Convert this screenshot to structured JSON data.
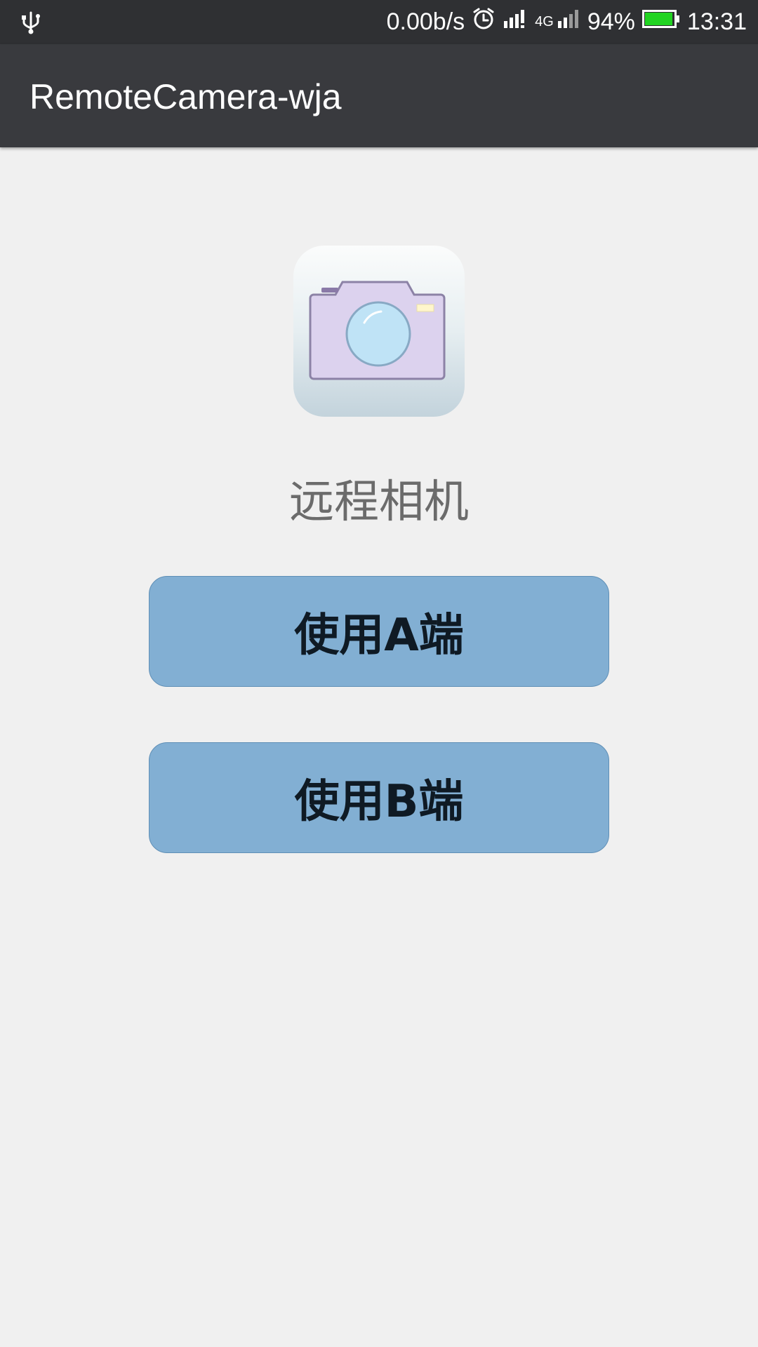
{
  "status_bar": {
    "network_speed": "0.00b/s",
    "network_type": "4G",
    "battery_percent": "94%",
    "battery_level": 0.94,
    "time": "13:31",
    "icons": [
      "usb-icon",
      "alarm-icon",
      "signal-icon",
      "signal-4g-icon",
      "battery-icon"
    ],
    "battery_color": "#22d422"
  },
  "app_bar": {
    "title": "RemoteCamera-wja"
  },
  "main": {
    "logo_icon": "camera-icon",
    "app_name": "远程相机",
    "buttons": [
      {
        "label": "使用A端"
      },
      {
        "label": "使用B端"
      }
    ]
  },
  "colors": {
    "status_bar_bg": "#2f3033",
    "app_bar_bg": "#393a3e",
    "page_bg": "#f0f0f0",
    "button_bg": "#82afd3"
  }
}
